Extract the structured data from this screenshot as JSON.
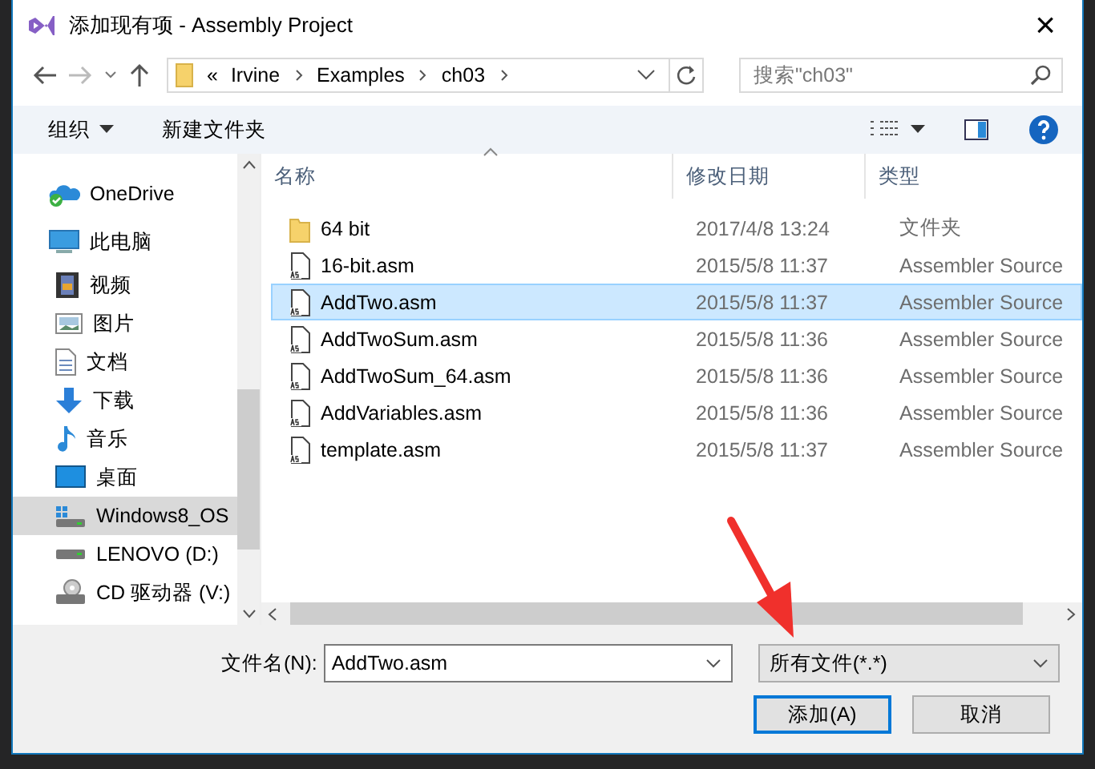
{
  "window": {
    "title": "添加现有项 - Assembly Project",
    "close": "×"
  },
  "nav": {
    "path": [
      "Irvine",
      "Examples",
      "ch03"
    ],
    "overflow": "«",
    "search": {
      "placeholder": "搜索\"ch03\""
    }
  },
  "toolbar": {
    "organize": "组织",
    "new_folder": "新建文件夹"
  },
  "sidebar": {
    "items": [
      {
        "label": "OneDrive",
        "kind": "cloud",
        "selected": false
      },
      {
        "label": "此电脑",
        "kind": "pc",
        "selected": false
      },
      {
        "label": "视频",
        "kind": "video",
        "selected": false
      },
      {
        "label": "图片",
        "kind": "image",
        "selected": false
      },
      {
        "label": "文档",
        "kind": "doc",
        "selected": false
      },
      {
        "label": "下载",
        "kind": "download",
        "selected": false
      },
      {
        "label": "音乐",
        "kind": "music",
        "selected": false
      },
      {
        "label": "桌面",
        "kind": "desktop",
        "selected": false
      },
      {
        "label": "Windows8_OS",
        "kind": "osdrive",
        "selected": true
      },
      {
        "label": "LENOVO (D:)",
        "kind": "drive",
        "selected": false
      },
      {
        "label": "CD 驱动器 (V:)",
        "kind": "cd",
        "selected": false
      }
    ]
  },
  "table": {
    "columns": [
      "名称",
      "修改日期",
      "类型"
    ],
    "rows": [
      {
        "kind": "folder",
        "name": "64 bit",
        "date": "2017/4/8 13:24",
        "type": "文件夹",
        "selected": false
      },
      {
        "kind": "file",
        "name": "16-bit.asm",
        "date": "2015/5/8 11:37",
        "type": "Assembler Source",
        "selected": false
      },
      {
        "kind": "file",
        "name": "AddTwo.asm",
        "date": "2015/5/8 11:37",
        "type": "Assembler Source",
        "selected": true
      },
      {
        "kind": "file",
        "name": "AddTwoSum.asm",
        "date": "2015/5/8 11:36",
        "type": "Assembler Source",
        "selected": false
      },
      {
        "kind": "file",
        "name": "AddTwoSum_64.asm",
        "date": "2015/5/8 11:36",
        "type": "Assembler Source",
        "selected": false
      },
      {
        "kind": "file",
        "name": "AddVariables.asm",
        "date": "2015/5/8 11:36",
        "type": "Assembler Source",
        "selected": false
      },
      {
        "kind": "file",
        "name": "template.asm",
        "date": "2015/5/8 11:37",
        "type": "Assembler Source",
        "selected": false
      }
    ]
  },
  "bottom": {
    "filename_label": "文件名(N):",
    "filename": "AddTwo.asm",
    "filter": "所有文件(*.*)",
    "buttons": [
      {
        "label": "添加(A)",
        "kind": "primary"
      },
      {
        "label": "取消",
        "kind": "normal"
      }
    ]
  }
}
